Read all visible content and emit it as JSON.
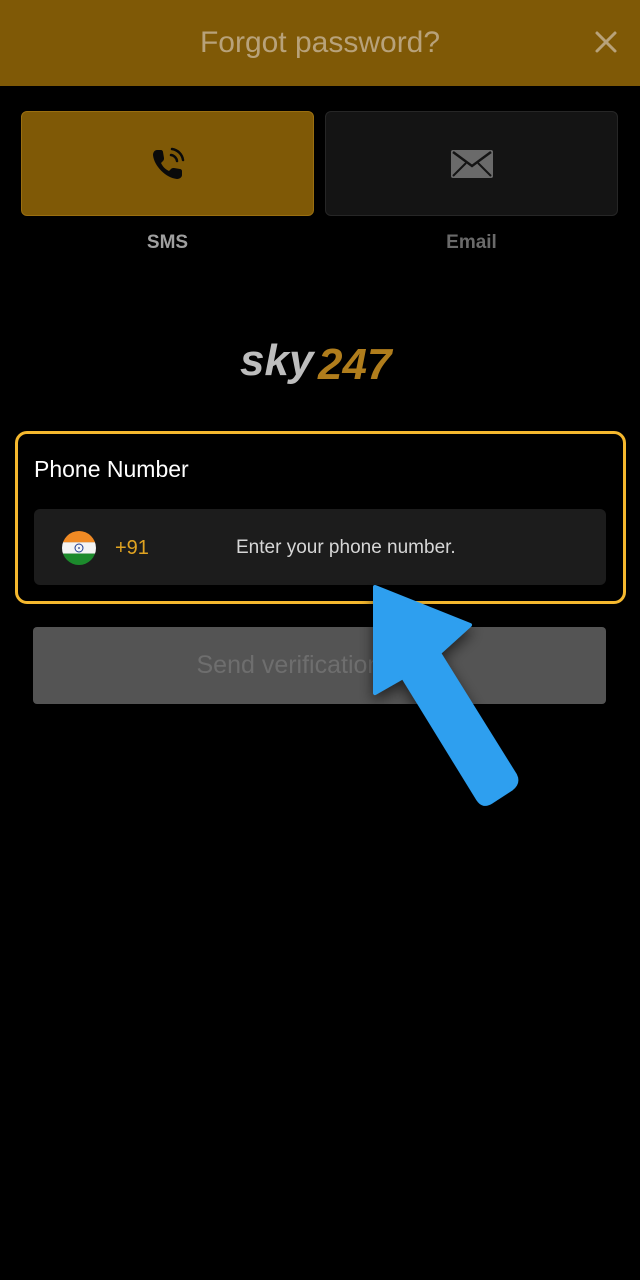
{
  "header": {
    "title": "Forgot password?",
    "close_icon": "close-icon"
  },
  "tabs": [
    {
      "label": "SMS",
      "icon": "phone-call-icon",
      "active": true
    },
    {
      "label": "Email",
      "icon": "envelope-icon",
      "active": false
    }
  ],
  "logo": {
    "text_sky": "sky",
    "text_247": "247"
  },
  "phone": {
    "label": "Phone Number",
    "country_flag": "india-flag-icon",
    "country_code": "+91",
    "placeholder": "Enter your phone number.",
    "value": ""
  },
  "send_button": {
    "label": "Send verification code"
  },
  "overlay": {
    "arrow_icon": "pointer-arrow-icon",
    "highlight_color": "#f5b82e",
    "arrow_color": "#2f9fef"
  },
  "colors": {
    "brand": "#7f5906",
    "accent": "#e0a321",
    "background": "#000000"
  }
}
